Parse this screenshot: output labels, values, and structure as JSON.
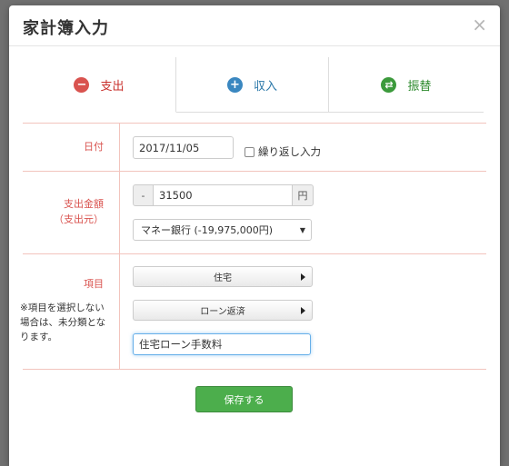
{
  "modal": {
    "title": "家計簿入力",
    "close": "×"
  },
  "tabs": [
    {
      "label": "支出",
      "icon": "minus-circle-icon",
      "color": "#c9302c",
      "glyph": "−"
    },
    {
      "label": "収入",
      "icon": "plus-circle-icon",
      "color": "#2a77a8",
      "glyph": "+"
    },
    {
      "label": "振替",
      "icon": "transfer-circle-icon",
      "color": "#2e8b2e",
      "glyph": "⇄"
    }
  ],
  "date": {
    "label": "日付",
    "value": "2017/11/05",
    "repeat_label": "繰り返し入力"
  },
  "amount": {
    "label": "支出金額",
    "sublabel": "（支出元）",
    "sign": "-",
    "value": "31500",
    "unit": "円",
    "account": "マネー銀行 (-19,975,000円)"
  },
  "category": {
    "label": "項目",
    "note": "※項目を選択しない場合は、未分類となります。",
    "main": "住宅",
    "sub": "ローン返済",
    "memo": "住宅ローン手数料"
  },
  "save_label": "保存する"
}
